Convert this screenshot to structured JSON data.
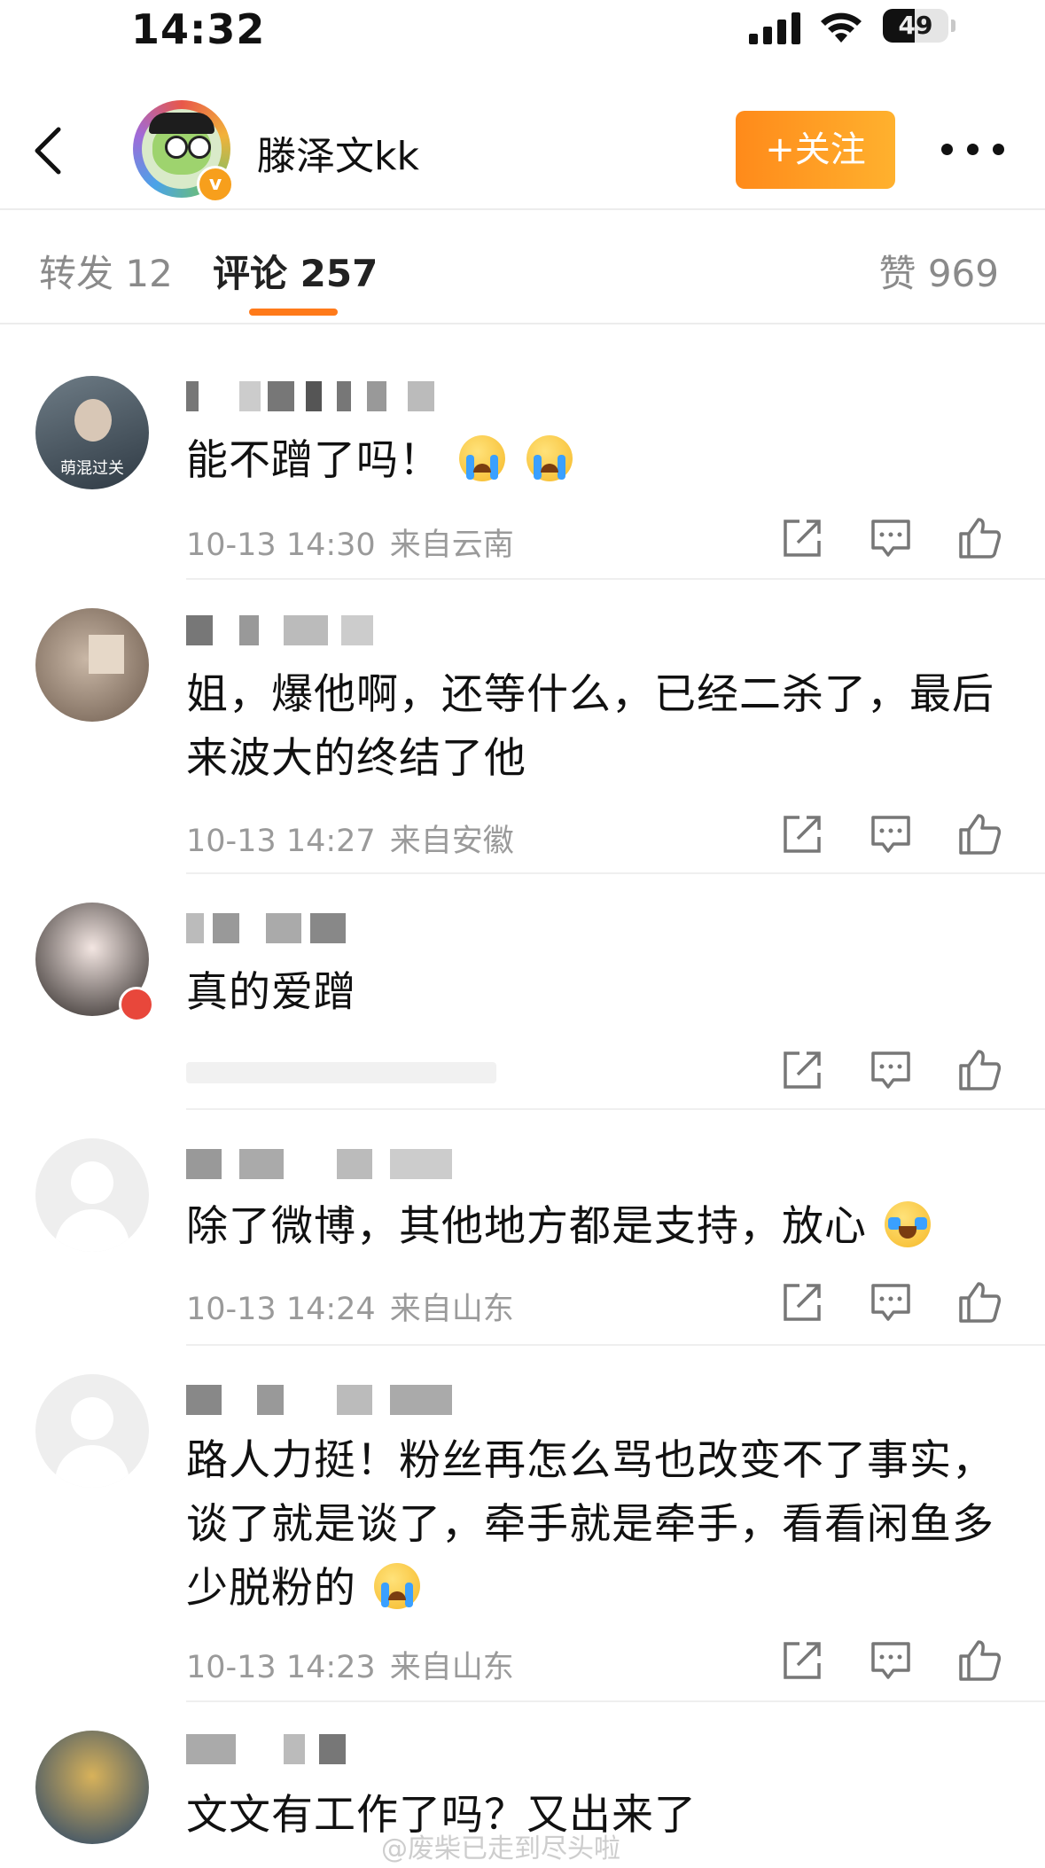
{
  "status_bar": {
    "time": "14:32",
    "battery": "49",
    "battery_level": 0.49
  },
  "header": {
    "profile_name": "滕泽文kk",
    "follow_label": "+关注",
    "verified_icon": "verified-badge"
  },
  "tabs": {
    "reposts": "转发 12",
    "comments": "评论 257",
    "likes": "赞 969"
  },
  "comments": [
    {
      "text": "能不蹭了吗！",
      "emoji": [
        "crying-face",
        "crying-face"
      ],
      "time": "10-13 14:30",
      "location": "来自云南",
      "avatar_caption": "萌混过关"
    },
    {
      "text": "姐，爆他啊，还等什么，已经二杀了，最后来波大的终结了他",
      "time": "10-13 14:27",
      "location": "来自安徽"
    },
    {
      "text": "真的爱蹭"
    },
    {
      "text": "除了微博，其他地方都是支持，放心",
      "emoji": [
        "tears-of-joy"
      ],
      "time": "10-13 14:24",
      "location": "来自山东"
    },
    {
      "text": "路人力挺！粉丝再怎么骂也改变不了事实，谈了就是谈了，牵手就是牵手，看看闲鱼多少脱粉的",
      "emoji": [
        "crying-face"
      ],
      "time": "10-13 14:23",
      "location": "来自山东"
    },
    {
      "text": "文文有工作了吗？又出来了"
    }
  ],
  "watermark": "@废柴已走到尽头啦",
  "icons": {
    "share": "share-icon",
    "comment": "comment-icon",
    "like": "like-icon"
  },
  "colors": {
    "accent": "#ff7a1a",
    "follow_button": "#ff9a20",
    "meta_text": "#9a9a9a"
  }
}
